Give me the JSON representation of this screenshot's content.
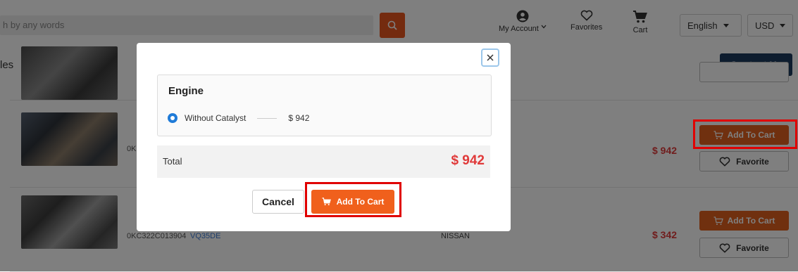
{
  "header": {
    "search_placeholder": "h by any words",
    "my_account_label": "My Account",
    "favorites_label": "Favorites",
    "cart_label": "Cart",
    "language": "English",
    "currency": "USD"
  },
  "subbar": {
    "label": "les",
    "contact_label": "Contact Us"
  },
  "listing": {
    "rows": [
      {
        "stock_code": "0K",
        "model": "",
        "make": "",
        "price": "$ 942",
        "add_to_cart_label": "Add To Cart",
        "favorite_label": "Favorite"
      },
      {
        "stock_code": "0KC322C013904",
        "model": "VQ35DE",
        "make": "NISSAN",
        "price": "$ 342",
        "add_to_cart_label": "Add To Cart",
        "favorite_label": "Favorite"
      }
    ]
  },
  "modal": {
    "title": "Engine",
    "option_label": "Without Catalyst",
    "option_price": "$ 942",
    "total_label": "Total",
    "total_value": "$ 942",
    "cancel_label": "Cancel",
    "add_to_cart_label": "Add To Cart"
  },
  "colors": {
    "accent_orange": "#e0601e",
    "price_red": "#e03a3a",
    "contact_navy": "#1c3a5e",
    "highlight_red": "#e00000",
    "radio_blue": "#1f7bd8"
  },
  "icons": {
    "search": "search-icon",
    "account": "user-icon",
    "favorites": "heart-icon",
    "cart": "cart-icon",
    "close": "close-icon"
  }
}
